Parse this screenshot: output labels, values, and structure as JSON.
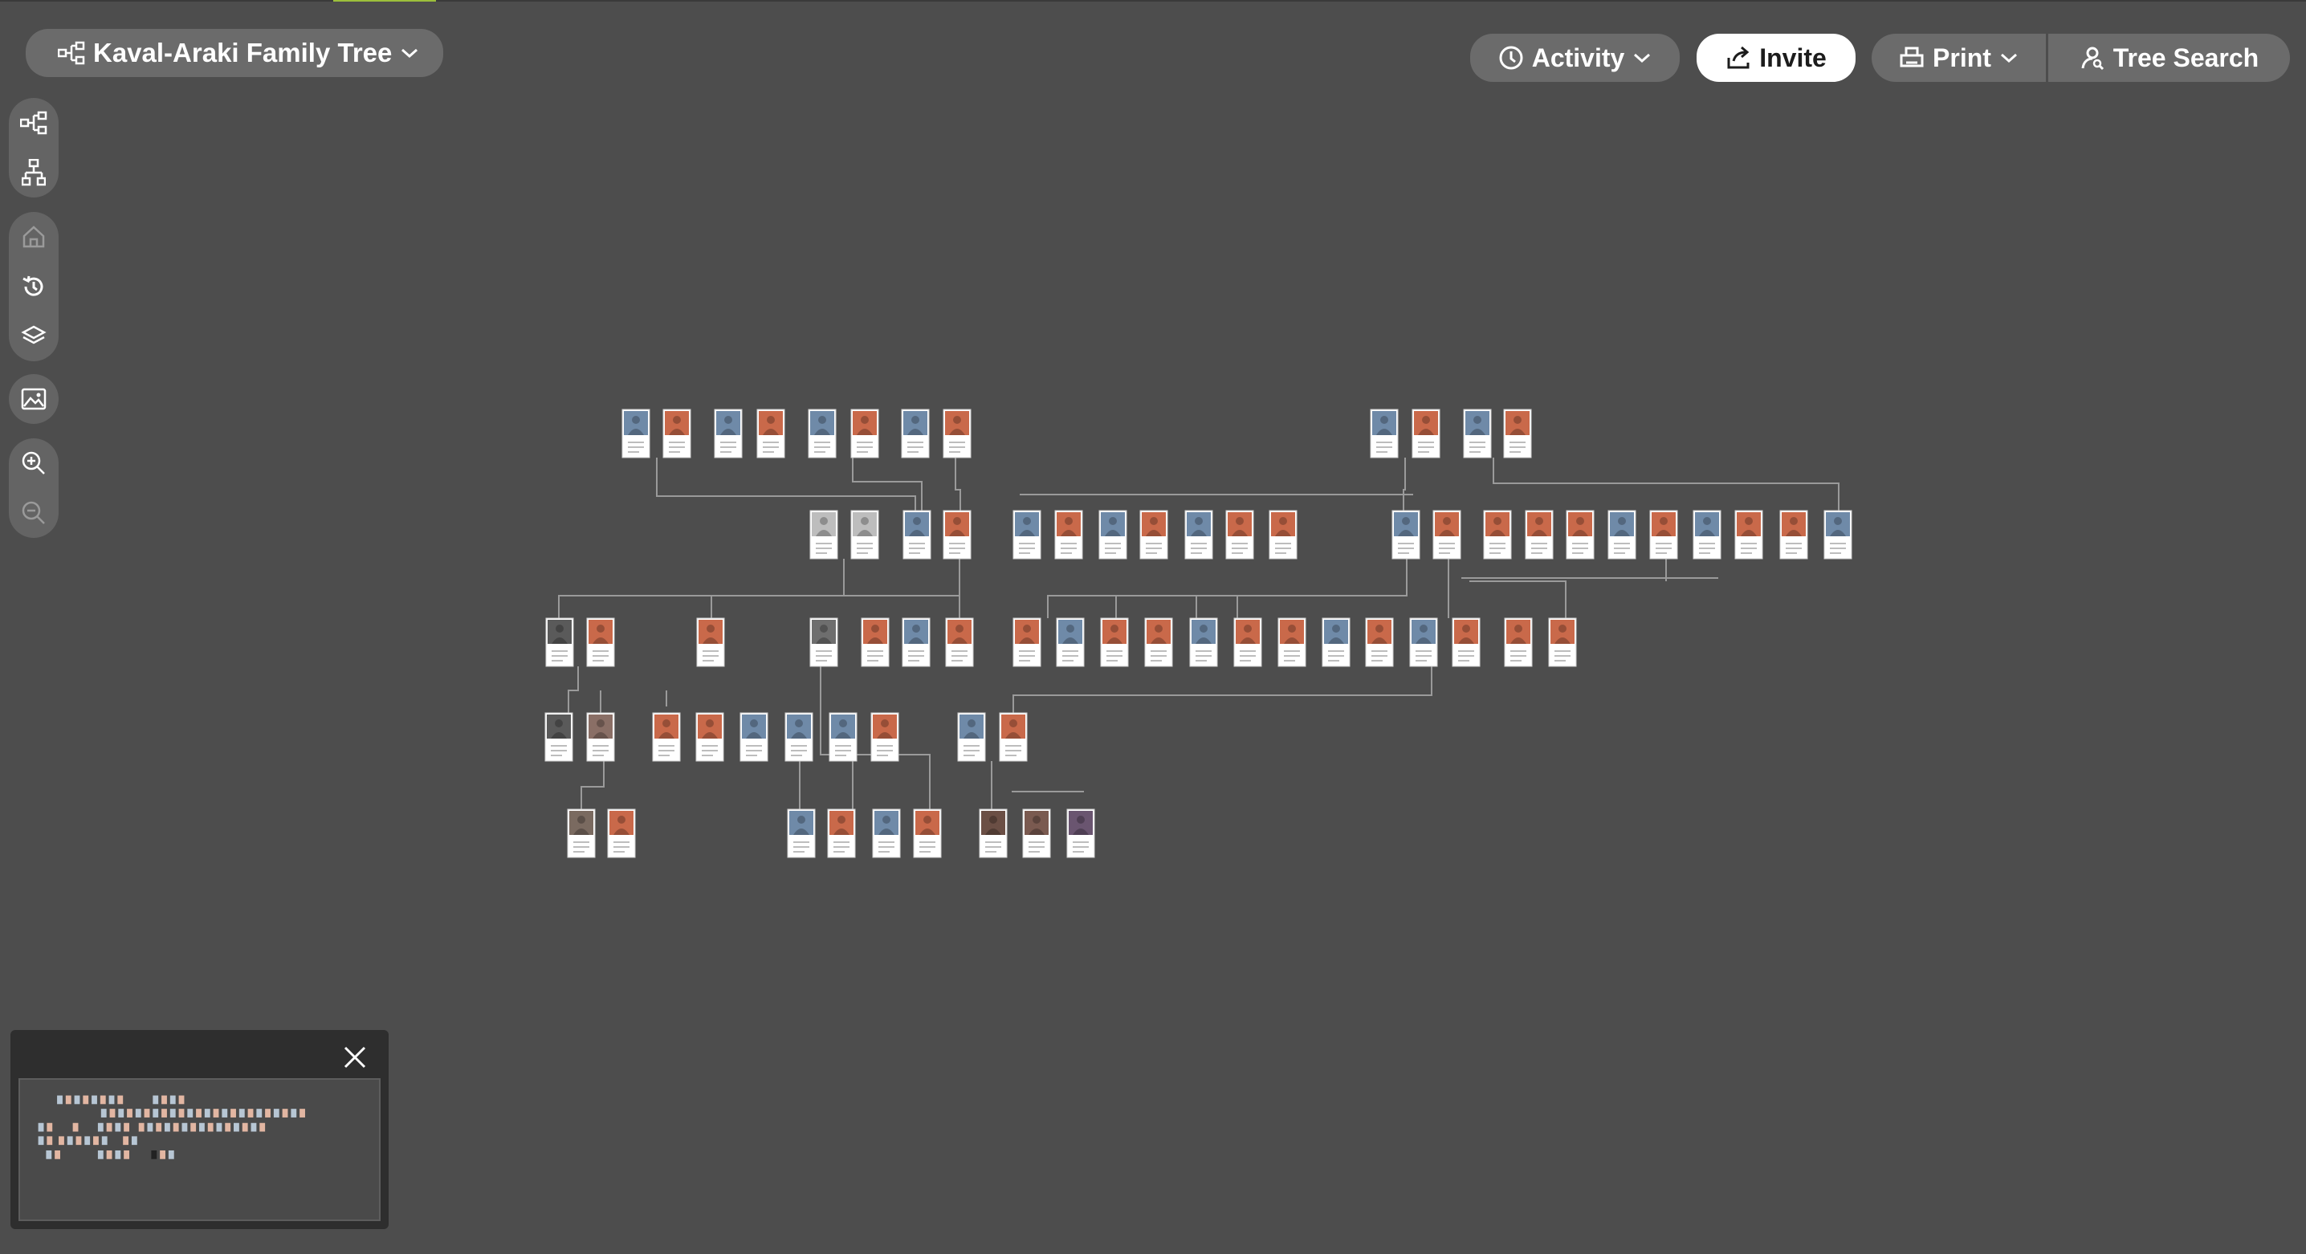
{
  "header": {
    "tree_title": "Kaval-Araki Family Tree",
    "activity_label": "Activity",
    "invite_label": "Invite",
    "print_label": "Print",
    "tree_search_label": "Tree Search"
  },
  "toolbar": {
    "tools": [
      "pedigree-view-icon",
      "descendant-view-icon",
      "home-icon",
      "history-icon",
      "layers-icon",
      "photo-icon",
      "zoom-in-icon",
      "zoom-out-icon"
    ]
  },
  "colors": {
    "background": "#4d4d4d",
    "male_card": "#6f8aa8",
    "female_card": "#c9694a",
    "connector": "#9a9a9a",
    "accent": "#9cbf3b"
  },
  "minimap": {
    "close_icon": "close-icon"
  }
}
